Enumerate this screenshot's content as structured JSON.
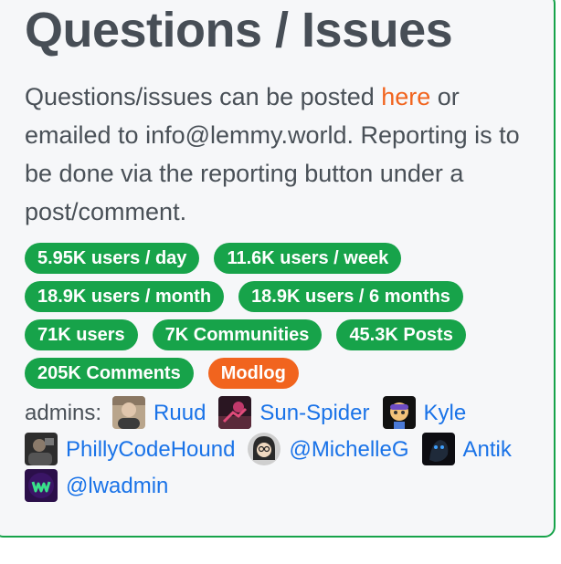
{
  "sidebar": {
    "title": "Questions / Issues",
    "description": {
      "before_link": "Questions/issues can be posted ",
      "link_text": "here",
      "after_link": " or emailed to info@lemmy.world. Reporting is to be done via the reporting button under a post/comment."
    },
    "stats": [
      "5.95K users / day",
      "11.6K users / week",
      "18.9K users / month",
      "18.9K users / 6 months",
      "71K users",
      "7K Communities",
      "45.3K Posts",
      "205K Comments"
    ],
    "modlog_label": "Modlog",
    "admins_label": "admins:",
    "admins": [
      "Ruud",
      "Sun-Spider",
      "Kyle",
      "PhillyCodeHound",
      "@MichelleG",
      "Antik",
      "@lwadmin"
    ]
  },
  "colors": {
    "accent_green": "#17a34a",
    "accent_orange": "#f1641e",
    "link_blue": "#1a73e8"
  }
}
